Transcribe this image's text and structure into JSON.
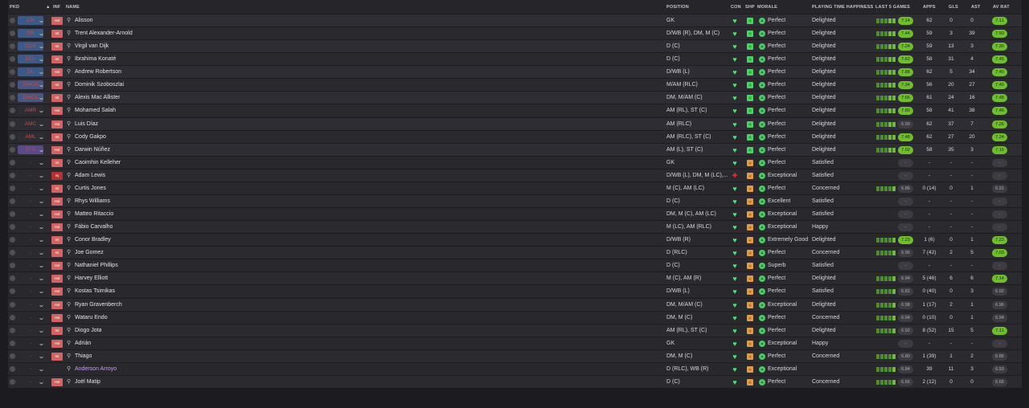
{
  "headers": {
    "pkd": "PKD",
    "sort_icon": "▲",
    "inf": "INF",
    "name": "NAME",
    "position": "POSITION",
    "con": "CON",
    "shp": "SHP",
    "morale": "MORALE",
    "pth": "PLAYING TIME HAPPINESS",
    "last5": "LAST 5 GAMES",
    "apps": "APPS",
    "gls": "GLS",
    "ast": "AST",
    "avrat": "AV RAT"
  },
  "colors": {
    "accent_green": "#6fbf2c",
    "injury_red": "#e0303a",
    "loan_purple": "#c6a0ea",
    "starter_row": "#2e2d33"
  },
  "players": [
    {
      "pos": "GK",
      "inf": "Hol",
      "name": "Alisson",
      "position": "GK",
      "mor": "Perfect",
      "pth": "Delighted",
      "last": "7.14",
      "apps": "62",
      "gls": "0",
      "ast": "0",
      "av": "7.11",
      "starter": true
    },
    {
      "pos": "DR",
      "inf": "Int",
      "name": "Trent Alexander-Arnold",
      "position": "D/WB (R), DM, M (C)",
      "mor": "Perfect",
      "pth": "Delighted",
      "last": "7.44",
      "apps": "59",
      "gls": "3",
      "ast": "39",
      "av": "7.50",
      "starter": true
    },
    {
      "pos": "DCR",
      "inf": "Int",
      "name": "Virgil van Dijk",
      "position": "D (C)",
      "mor": "Perfect",
      "pth": "Delighted",
      "last": "7.24",
      "apps": "59",
      "gls": "13",
      "ast": "3",
      "av": "7.30",
      "starter": true
    },
    {
      "pos": "DCL",
      "inf": "Int",
      "name": "Ibrahima Konaté",
      "position": "D (C)",
      "mor": "Perfect",
      "pth": "Delighted",
      "last": "7.62",
      "apps": "58",
      "gls": "31",
      "ast": "4",
      "av": "7.45",
      "starter": true
    },
    {
      "pos": "DL",
      "inf": "Hol",
      "name": "Andrew Robertson",
      "position": "D/WB (L)",
      "mor": "Perfect",
      "pth": "Delighted",
      "last": "7.88",
      "apps": "62",
      "gls": "5",
      "ast": "34",
      "av": "7.40",
      "starter": true
    },
    {
      "pos": "DMCR",
      "inf": "Int",
      "name": "Dominik Szoboszlai",
      "position": "M/AM (RLC)",
      "mor": "Perfect",
      "pth": "Delighted",
      "last": "7.34",
      "apps": "56",
      "gls": "20",
      "ast": "27",
      "av": "7.40",
      "starter": true
    },
    {
      "pos": "DMCL",
      "inf": "Int",
      "name": "Alexis Mac Allister",
      "position": "DM, M/AM (C)",
      "mor": "Perfect",
      "pth": "Delighted",
      "last": "7.66",
      "apps": "61",
      "gls": "24",
      "ast": "16",
      "av": "7.48",
      "starter": true
    },
    {
      "pos": "AMR",
      "inf": "Hol",
      "name": "Mohamed Salah",
      "position": "AM (RL), ST (C)",
      "mor": "Perfect",
      "pth": "Delighted",
      "last": "7.80",
      "apps": "58",
      "gls": "41",
      "ast": "38",
      "av": "7.46",
      "starter": true
    },
    {
      "pos": "AMC",
      "inf": "Hol",
      "name": "Luis Díaz",
      "position": "AM (RLC)",
      "mor": "Perfect",
      "pth": "Delighted",
      "last": "6.90",
      "apps": "62",
      "gls": "37",
      "ast": "7",
      "av": "7.26",
      "starter": true
    },
    {
      "pos": "AML",
      "inf": "Int",
      "name": "Cody Gakpo",
      "position": "AM (RLC), ST (C)",
      "mor": "Perfect",
      "pth": "Delighted",
      "last": "7.48",
      "apps": "62",
      "gls": "27",
      "ast": "20",
      "av": "7.24",
      "starter": true
    },
    {
      "pos": "STC",
      "inf": "Hol",
      "name": "Darwin Núñez",
      "position": "AM (L), ST (C)",
      "mor": "Perfect",
      "pth": "Delighted",
      "last": "7.02",
      "apps": "58",
      "gls": "35",
      "ast": "3",
      "av": "7.15",
      "starter": true
    },
    {
      "pos": "-",
      "inf": "Int",
      "name": "Caoimhin Kelleher",
      "position": "GK",
      "mor": "Perfect",
      "pth": "Satisfied",
      "last": "-",
      "apps": "-",
      "gls": "-",
      "ast": "-",
      "av": "-"
    },
    {
      "pos": "-",
      "inf": "Inj",
      "name": "Adam Lewis",
      "position": "D/WB (L), DM, M (LC),...",
      "mor": "Exceptional",
      "pth": "Satisfied",
      "last": "-",
      "apps": "-",
      "gls": "-",
      "ast": "-",
      "av": "-",
      "injured": true
    },
    {
      "pos": "-",
      "inf": "Int",
      "name": "Curtis Jones",
      "position": "M (C), AM (LC)",
      "mor": "Perfect",
      "pth": "Concerned",
      "last": "6.86",
      "apps": "0 (14)",
      "gls": "0",
      "ast": "1",
      "av": "6.91"
    },
    {
      "pos": "-",
      "inf": "Hol",
      "name": "Rhys Williams",
      "position": "D (C)",
      "mor": "Excellent",
      "pth": "Satisfied",
      "last": "-",
      "apps": "-",
      "gls": "-",
      "ast": "-",
      "av": "-"
    },
    {
      "pos": "-",
      "inf": "Hol",
      "name": "Matteo Ritaccio",
      "position": "DM, M (C), AM (LC)",
      "mor": "Exceptional",
      "pth": "Satisfied",
      "last": "-",
      "apps": "-",
      "gls": "-",
      "ast": "-",
      "av": "-"
    },
    {
      "pos": "-",
      "inf": "Hol",
      "name": "Fábio Carvalho",
      "position": "M (LC), AM (RLC)",
      "mor": "Exceptional",
      "pth": "Happy",
      "last": "-",
      "apps": "-",
      "gls": "-",
      "ast": "-",
      "av": "-"
    },
    {
      "pos": "-",
      "inf": "Int",
      "name": "Conor Bradley",
      "position": "D/WB (R)",
      "mor": "Extremely Good",
      "pth": "Delighted",
      "last": "7.23",
      "apps": "1 (6)",
      "gls": "0",
      "ast": "1",
      "av": "7.23"
    },
    {
      "pos": "-",
      "inf": "Int",
      "name": "Joe Gomez",
      "position": "D (RLC)",
      "mor": "Perfect",
      "pth": "Concerned",
      "last": "6.96",
      "apps": "7 (42)",
      "gls": "2",
      "ast": "5",
      "av": "7.03"
    },
    {
      "pos": "-",
      "inf": "Hol",
      "name": "Nathaniel Phillips",
      "position": "D (C)",
      "mor": "Superb",
      "pth": "Satisfied",
      "last": "-",
      "apps": "-",
      "gls": "-",
      "ast": "-",
      "av": "-"
    },
    {
      "pos": "-",
      "inf": "Hol",
      "name": "Harvey Elliott",
      "position": "M (C), AM (R)",
      "mor": "Perfect",
      "pth": "Delighted",
      "last": "6.94",
      "apps": "5 (46)",
      "gls": "6",
      "ast": "6",
      "av": "7.14"
    },
    {
      "pos": "-",
      "inf": "Hol",
      "name": "Kostas Tsimikas",
      "position": "D/WB (L)",
      "mor": "Perfect",
      "pth": "Satisfied",
      "last": "6.82",
      "apps": "0 (40)",
      "gls": "0",
      "ast": "3",
      "av": "6.92"
    },
    {
      "pos": "-",
      "inf": "Hol",
      "name": "Ryan Gravenberch",
      "position": "DM, M/AM (C)",
      "mor": "Exceptional",
      "pth": "Delighted",
      "last": "6.98",
      "apps": "1 (17)",
      "gls": "2",
      "ast": "1",
      "av": "6.96"
    },
    {
      "pos": "-",
      "inf": "Hol",
      "name": "Wataru Endo",
      "position": "DM, M (C)",
      "mor": "Perfect",
      "pth": "Concerned",
      "last": "6.94",
      "apps": "0 (10)",
      "gls": "0",
      "ast": "1",
      "av": "6.94"
    },
    {
      "pos": "-",
      "inf": "Int",
      "name": "Diogo Jota",
      "position": "AM (RL), ST (C)",
      "mor": "Perfect",
      "pth": "Delighted",
      "last": "6.92",
      "apps": "8 (52)",
      "gls": "15",
      "ast": "5",
      "av": "7.11"
    },
    {
      "pos": "-",
      "inf": "Hol",
      "name": "Adrián",
      "position": "GK",
      "mor": "Exceptional",
      "pth": "Happy",
      "last": "-",
      "apps": "-",
      "gls": "-",
      "ast": "-",
      "av": "-"
    },
    {
      "pos": "-",
      "inf": "Int",
      "name": "Thiago",
      "position": "DM, M (C)",
      "mor": "Perfect",
      "pth": "Concerned",
      "last": "6.80",
      "apps": "1 (39)",
      "gls": "1",
      "ast": "2",
      "av": "6.86"
    },
    {
      "pos": "-",
      "inf": "",
      "name": "Anderson Arroyo",
      "position": "D (RLC), WB (R)",
      "mor": "Exceptional",
      "pth": "",
      "last": "6.84",
      "apps": "39",
      "gls": "11",
      "ast": "3",
      "av": "6.93",
      "loan": true
    },
    {
      "pos": "-",
      "inf": "Hol",
      "name": "Joël Matip",
      "position": "D (C)",
      "mor": "Perfect",
      "pth": "Concerned",
      "last": "6.66",
      "apps": "2 (12)",
      "gls": "0",
      "ast": "0",
      "av": "6.66"
    }
  ]
}
